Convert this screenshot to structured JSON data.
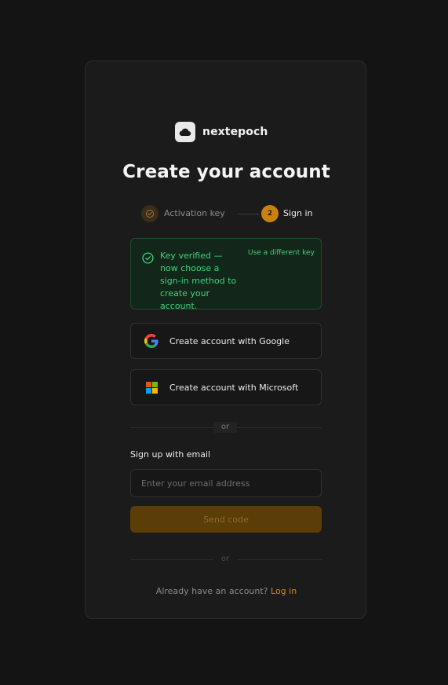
{
  "brand": {
    "name": "nextepoch",
    "logo_icon": "cloud-icon"
  },
  "title": "Create your account",
  "steps": [
    {
      "label": "Activation key",
      "state": "completed",
      "icon": "check-circle-icon"
    },
    {
      "number": "2",
      "label": "Sign in",
      "state": "active"
    }
  ],
  "notice": {
    "text": "Key verified — now choose a sign-in method to create your account.",
    "link": "Use a different key",
    "icon": "check-circle-icon",
    "color": "#3fd37a"
  },
  "sso": {
    "google": {
      "label": "Create account with Google",
      "icon": "google-icon"
    },
    "microsoft": {
      "label": "Create account with Microsoft",
      "icon": "microsoft-icon"
    }
  },
  "divider1": "or",
  "email": {
    "label": "Sign up with email",
    "placeholder": "Enter your email address",
    "value": ""
  },
  "send_button": "Send code",
  "divider2": "or",
  "footer": {
    "text": "Already have an account?",
    "link": "Log in"
  },
  "colors": {
    "accent": "#c8820f",
    "link": "#d48a17",
    "success": "#3fd37a",
    "background": "#141414",
    "card": "#1b1b1b"
  }
}
